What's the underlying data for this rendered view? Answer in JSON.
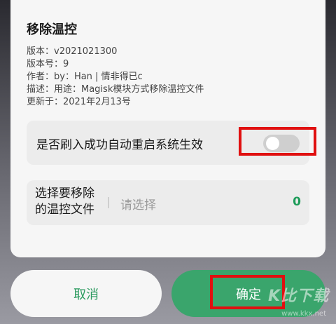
{
  "dialog": {
    "title": "移除温控",
    "info": [
      "版本：v2021021300",
      "版本号：9",
      "作者：by：Han | 情非得已c",
      "描述：用途：Magisk模块方式移除温控文件",
      "更新于：2021年2月13号"
    ],
    "reboot_label": "是否刷入成功自动重启系统生效",
    "reboot_enabled": false,
    "select_label": "选择要移除的温控文件",
    "select_placeholder": "请选择",
    "select_count": "0",
    "cancel_label": "取消",
    "confirm_label": "确定"
  },
  "watermark": {
    "logo": "K比下载",
    "url": "www.kkx.net"
  },
  "colors": {
    "accent": "#3aa56c",
    "highlight": "#e01010"
  }
}
